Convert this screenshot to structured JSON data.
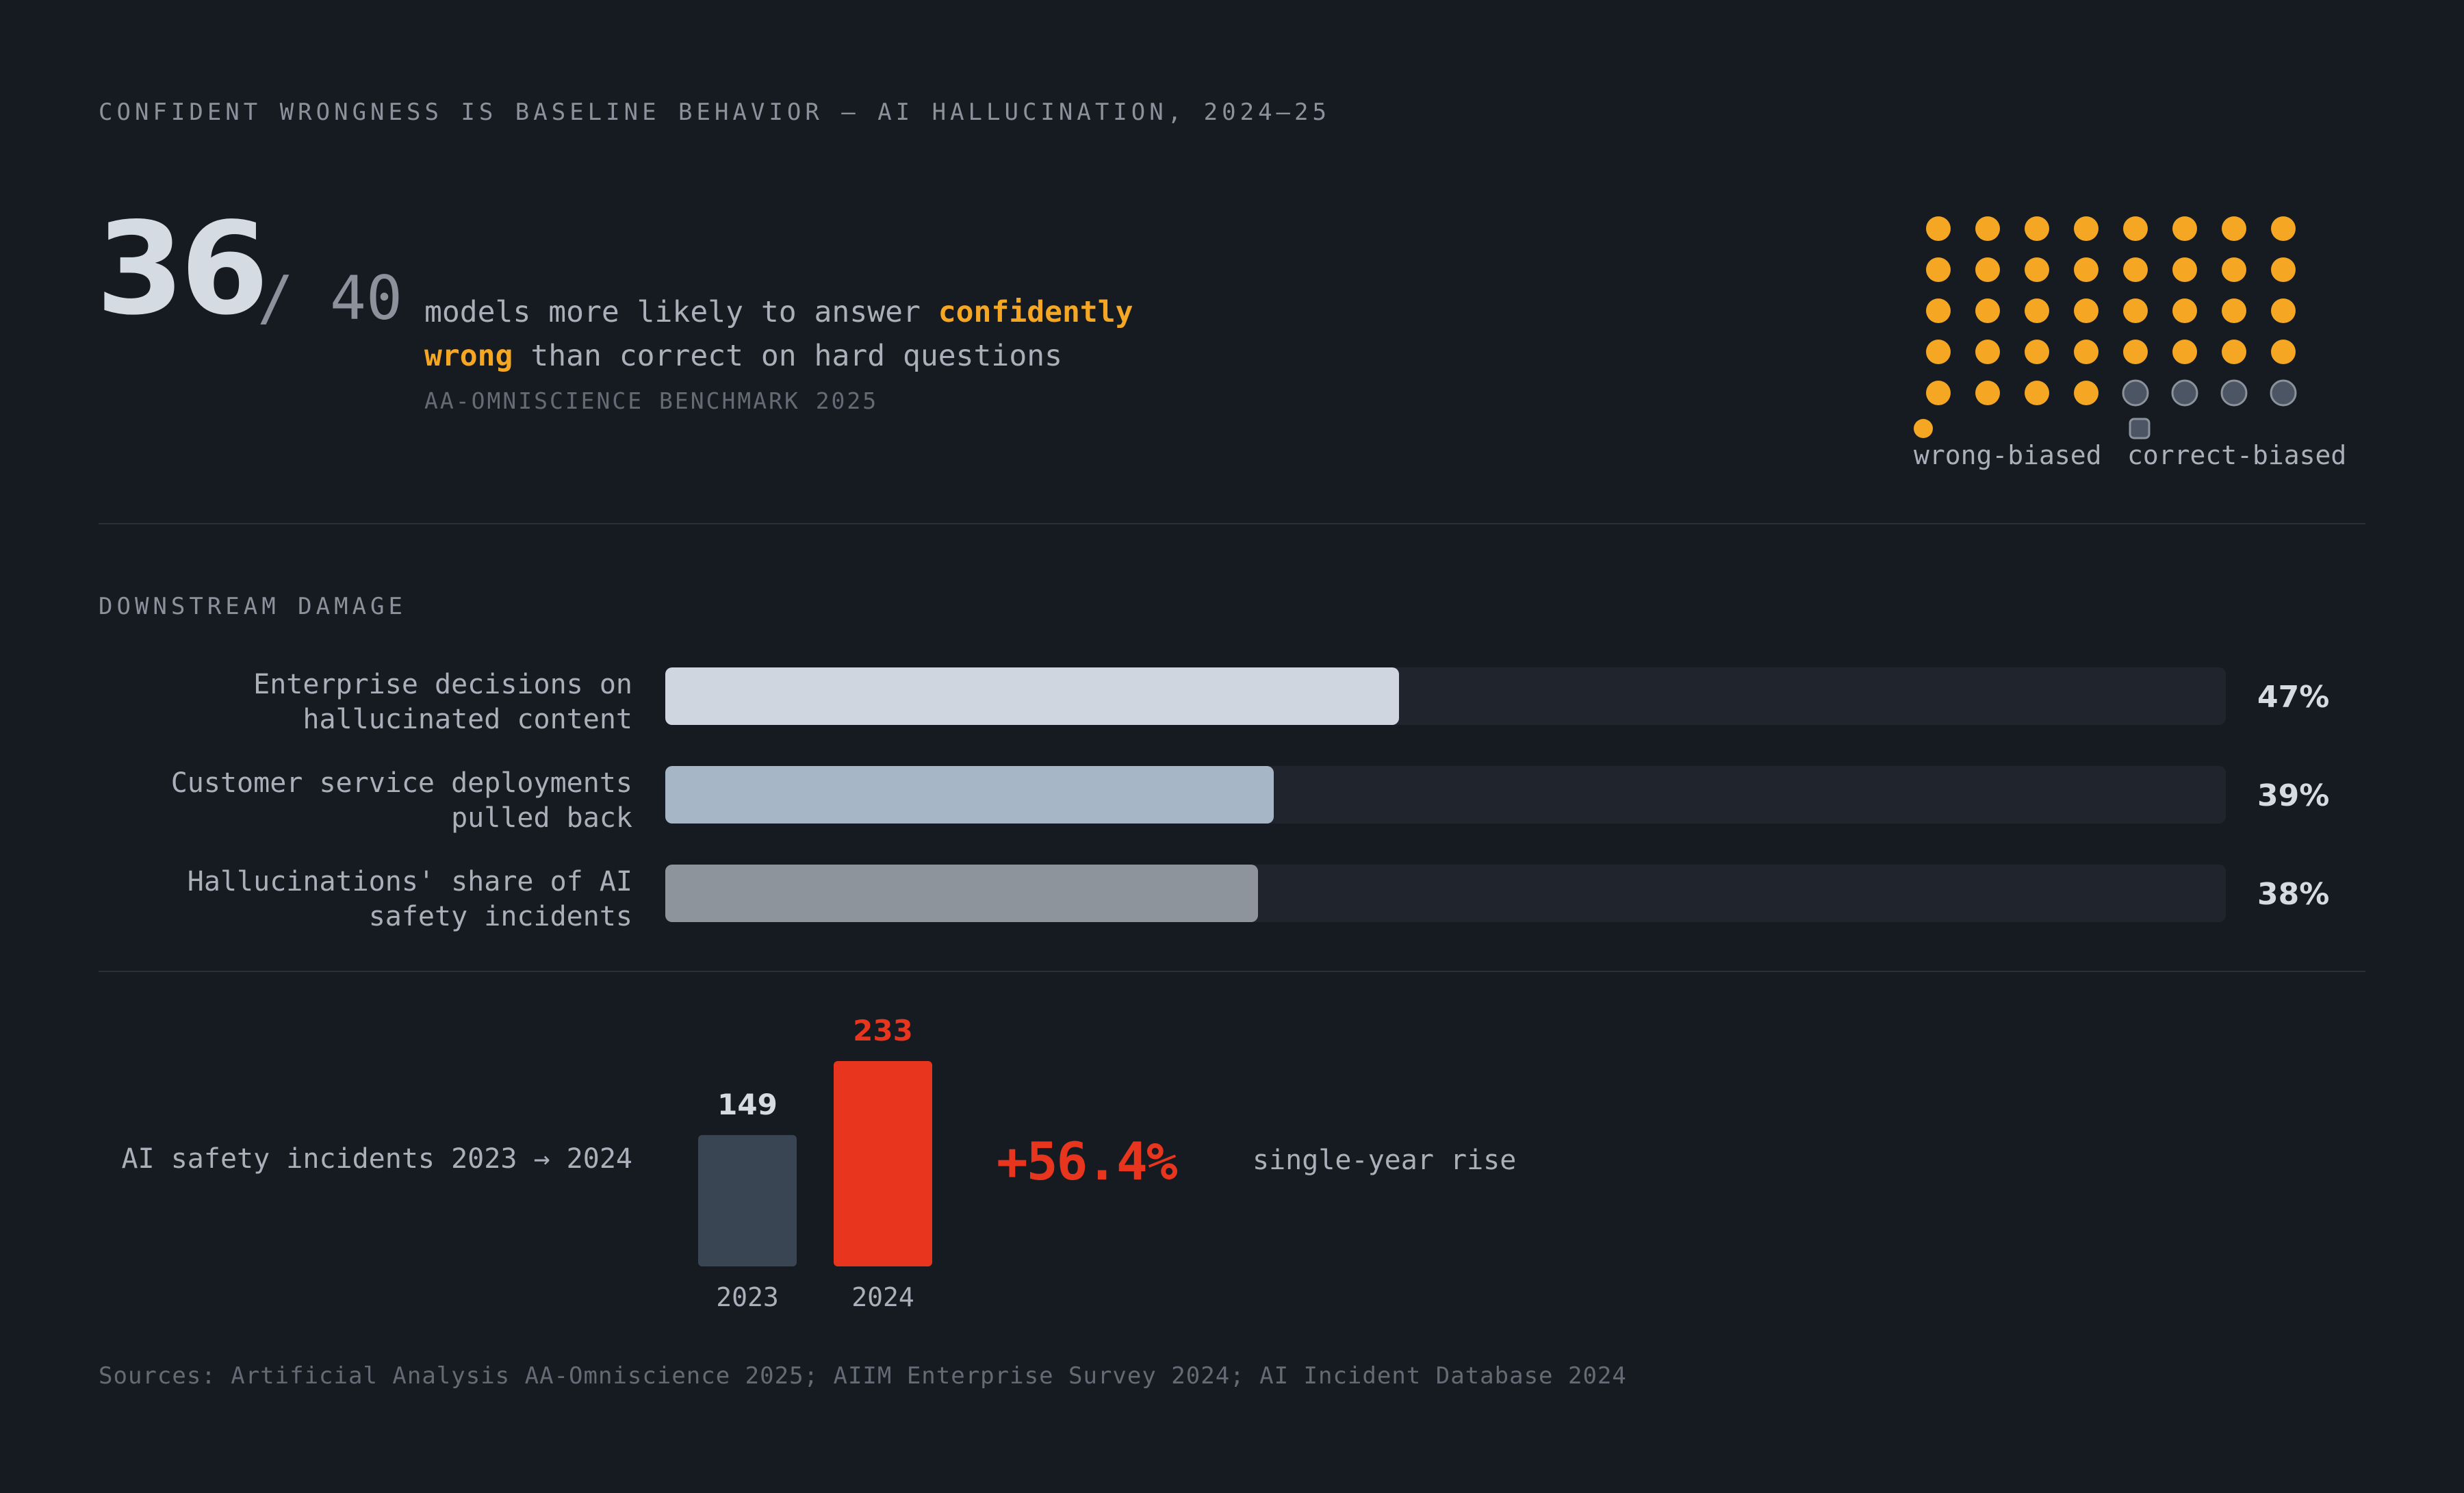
{
  "kicker": "CONFIDENT WRONGNESS IS BASELINE BEHAVIOR — AI HALLUCINATION, 2024–25",
  "hero": {
    "count": "36",
    "total": "/ 40",
    "text_pre": "models more likely to answer ",
    "text_hl1": "confidently",
    "text_hl2": "wrong",
    "text_post": " than correct on hard questions",
    "source": "AA-OMNISCIENCE BENCHMARK 2025"
  },
  "colors": {
    "background": "#161b22",
    "accent": "#f5a623",
    "danger": "#e8351e",
    "muted_dot": "#4b5563",
    "bar_1": "#d0d6df",
    "bar_2": "#a7b6c7",
    "bar_3": "#8e949c",
    "bar_2023": "#3a4554"
  },
  "section_label": "DOWNSTREAM DAMAGE",
  "footer": {
    "sources": "Sources: Artificial Analysis AA-Omniscience 2025; AIIM Enterprise Survey 2024; AI Incident Database 2024"
  },
  "chart_data": [
    {
      "type": "waffle",
      "total": 40,
      "columns": 8,
      "series": [
        {
          "name": "wrong-biased",
          "value": 36,
          "color": "#f5a623"
        },
        {
          "name": "correct-biased",
          "value": 4,
          "color": "#4b5563"
        }
      ],
      "legend": "bottom"
    },
    {
      "type": "bar",
      "orientation": "horizontal",
      "categories": [
        "Enterprise decisions on hallucinated content",
        "Customer service deployments pulled back",
        "Hallucinations' share of AI safety incidents"
      ],
      "category_lines": [
        [
          "Enterprise decisions on",
          "hallucinated content"
        ],
        [
          "Customer service deployments",
          "pulled back"
        ],
        [
          "Hallucinations' share of AI",
          "safety incidents"
        ]
      ],
      "values": [
        47,
        39,
        38
      ],
      "value_labels": [
        "47%",
        "39%",
        "38%"
      ],
      "xlim": [
        0,
        100
      ]
    },
    {
      "type": "bar",
      "label": "AI safety incidents 2023 → 2024",
      "categories": [
        "2023",
        "2024"
      ],
      "values": [
        149,
        233
      ],
      "value_labels": [
        "149",
        "233"
      ],
      "change": "+56.4%",
      "change_note": "single-year rise"
    }
  ]
}
